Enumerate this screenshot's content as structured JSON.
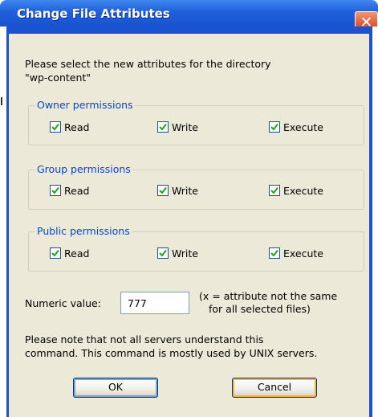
{
  "window": {
    "title": "Change File Attributes"
  },
  "intro": {
    "line1": "Please select the new attributes for the directory",
    "line2": "\"wp-content\""
  },
  "groups": [
    {
      "legend": "Owner permissions",
      "read": "Read",
      "write": "Write",
      "execute": "Execute",
      "read_checked": true,
      "write_checked": true,
      "execute_checked": true
    },
    {
      "legend": "Group permissions",
      "read": "Read",
      "write": "Write",
      "execute": "Execute",
      "read_checked": true,
      "write_checked": true,
      "execute_checked": true
    },
    {
      "legend": "Public permissions",
      "read": "Read",
      "write": "Write",
      "execute": "Execute",
      "read_checked": true,
      "write_checked": true,
      "execute_checked": true
    }
  ],
  "numeric": {
    "label": "Numeric value:",
    "value": "777",
    "note_line1": "(x = attribute not the same",
    "note_line2": "for all selected files)"
  },
  "footer_note": {
    "line1": "Please note that not all servers understand this",
    "line2": "command. This command is mostly used by UNIX servers."
  },
  "buttons": {
    "ok": "OK",
    "cancel": "Cancel"
  },
  "icons": {
    "close": "close-icon",
    "check": "checkmark-icon"
  },
  "colors": {
    "title_bar": "#1f5fdc",
    "group_legend": "#0046d5",
    "check": "#21a121",
    "close_button": "#df5a33"
  }
}
